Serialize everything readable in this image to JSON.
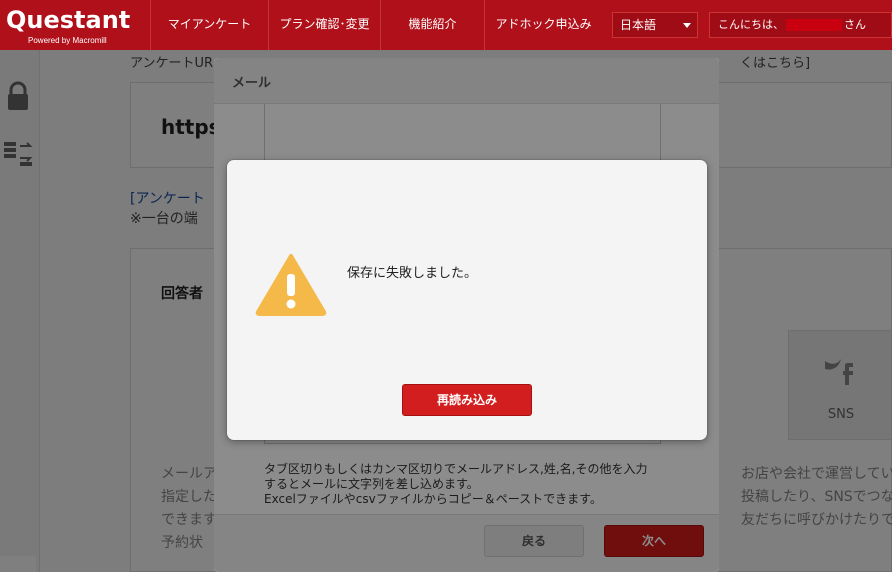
{
  "header": {
    "logo_text": "Questant",
    "logo_sub": "Powered by Macromill",
    "nav": [
      "マイアンケート",
      "プラン確認･変更",
      "機能紹介",
      "アドホック申込み"
    ],
    "language": "日本語",
    "greeting_prefix": "こんにちは、",
    "greeting_suffix": "さん"
  },
  "background": {
    "line_top": "アンケートUR",
    "line_top_right": "くはこちら]",
    "url_text": "https",
    "link_text": "[アンケート",
    "note_text": "※一台の端",
    "section_title": "回答者",
    "left_para": [
      "メールア",
      "指定した",
      "できます",
      "予約状"
    ],
    "right_para": [
      "お店や会社で運営してい",
      "投稿したり、SNSでつな",
      "友だちに呼びかけたりで"
    ],
    "sns_label": "SNS"
  },
  "mail_modal": {
    "title": "メール",
    "help_lines": [
      "タブ区切りもしくはカンマ区切りでメールアドレス,姓,名,その他を入力",
      "するとメールに文字列を差し込めます。",
      "Excelファイルやcsvファイルからコピー＆ペーストできます。"
    ],
    "back_label": "戻る",
    "next_label": "次へ"
  },
  "error_dialog": {
    "message": "保存に失敗しました。",
    "reload_label": "再読み込み"
  },
  "colors": {
    "brand_red": "#b0101a",
    "button_red": "#d21e1e",
    "warning_yellow": "#f5b94a"
  }
}
